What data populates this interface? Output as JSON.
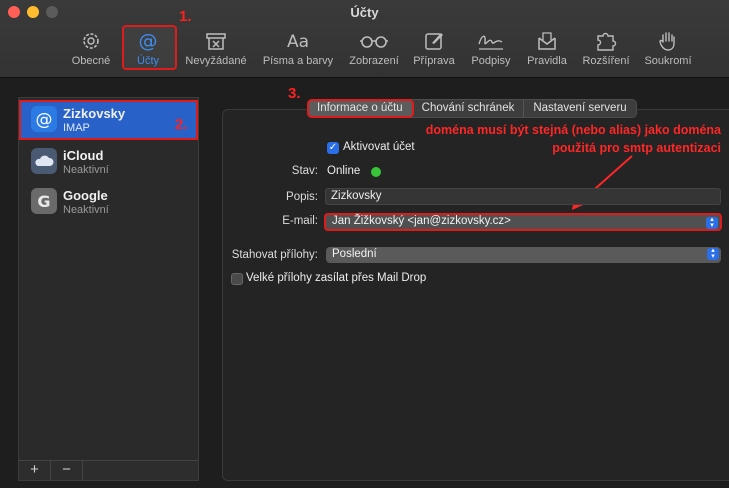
{
  "window": {
    "title": "Účty"
  },
  "toolbar": {
    "items": [
      {
        "label": "Obecné",
        "icon": "gear-icon"
      },
      {
        "label": "Účty",
        "icon": "at-icon"
      },
      {
        "label": "Nevyžádané",
        "icon": "junk-icon"
      },
      {
        "label": "Písma a barvy",
        "icon": "fonts-icon"
      },
      {
        "label": "Zobrazení",
        "icon": "glasses-icon"
      },
      {
        "label": "Příprava",
        "icon": "compose-icon"
      },
      {
        "label": "Podpisy",
        "icon": "signature-icon"
      },
      {
        "label": "Pravidla",
        "icon": "rules-icon"
      },
      {
        "label": "Rozšíření",
        "icon": "puzzle-icon"
      },
      {
        "label": "Soukromí",
        "icon": "hand-icon"
      }
    ]
  },
  "steps": {
    "s1": "1.",
    "s2": "2.",
    "s3": "3."
  },
  "accounts": [
    {
      "name": "Zizkovsky",
      "sub": "IMAP",
      "icon": "at-icon"
    },
    {
      "name": "iCloud",
      "sub": "Neaktivní",
      "icon": "icloud-icon"
    },
    {
      "name": "Google",
      "sub": "Neaktivní",
      "icon": "google-icon"
    }
  ],
  "sidebar_footer": {
    "add": "+",
    "remove": "−"
  },
  "tabs": [
    "Informace o účtu",
    "Chování schránek",
    "Nastavení serveru"
  ],
  "annotation": {
    "line1": "doména musí být stejná (nebo alias) jako doména",
    "line2": "použitá pro smtp autentizaci"
  },
  "form": {
    "enable_label": "Aktivovat účet",
    "status_label": "Stav:",
    "status_value": "Online",
    "description_label": "Popis:",
    "description_value": "Zizkovsky",
    "email_label": "E-mail:",
    "email_value": "Jan Žižkovský <jan@zizkovsky.cz>",
    "download_label": "Stahovat přílohy:",
    "download_value": "Poslední",
    "maildrop_label": "Velké přílohy zasílat přes Mail Drop"
  },
  "colors": {
    "accent": "#2a6ee8",
    "annotation": "#ff2626",
    "online": "#39c43a",
    "selection": "#2862c8"
  }
}
